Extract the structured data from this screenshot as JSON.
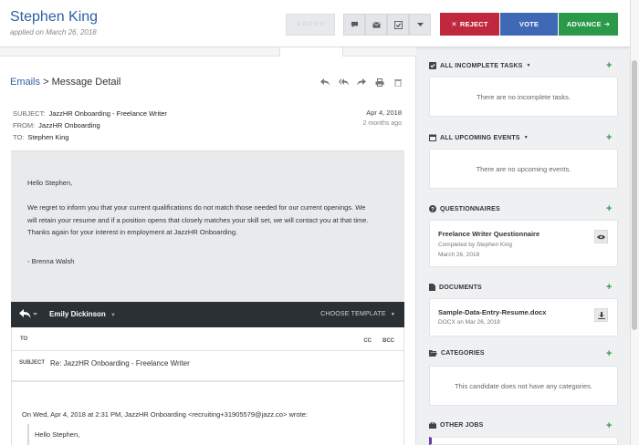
{
  "header": {
    "candidate_name": "Stephen King",
    "applied_text": "applied on March 26, 2018",
    "rating_stars": "☆☆☆☆☆",
    "actions": {
      "reject": "REJECT",
      "vote": "VOTE",
      "advance": "ADVANCE"
    }
  },
  "breadcrumb": {
    "parent": "Emails",
    "separator": " > ",
    "current": "Message Detail"
  },
  "message": {
    "subject_label": "SUBJECT:",
    "subject": "JazzHR Onboarding - Freelance Writer",
    "from_label": "FROM:",
    "from": "JazzHR Onboarding",
    "to_label": "TO:",
    "to": "Stephen King",
    "date": "Apr 4, 2018",
    "relative_date": "2 months ago",
    "greeting": "Hello Stephen,",
    "paragraph": "We regret to inform you that your current qualifications do not match those needed for our current openings. We will retain your resume and if a position opens that closely matches your skill set, we will contact you at that time. Thanks again for your interest in employment at JazzHR Onboarding.",
    "signature": "- Brenna Walsh"
  },
  "reply": {
    "from_name": "Emily Dickinson",
    "choose_template": "CHOOSE TEMPLATE",
    "to_label": "TO",
    "cc_label": "CC",
    "bcc_label": "BCC",
    "subject_label": "SUBJECT",
    "subject_value": "Re: JazzHR Onboarding - Freelance Writer",
    "quote_header": "On Wed, Apr 4, 2018 at 2:31 PM, JazzHR Onboarding <recruiting+31905579@jazz.co> wrote:",
    "quote_greeting": "Hello Stephen,"
  },
  "sidebar": {
    "tasks": {
      "title": "ALL INCOMPLETE TASKS",
      "empty": "There are no incomplete tasks."
    },
    "events": {
      "title": "ALL UPCOMING EVENTS",
      "empty": "There are no upcoming events."
    },
    "questionnaires": {
      "title": "QUESTIONNAIRES",
      "item_title": "Freelance Writer Questionnaire",
      "item_sub1": "Completed by Stephen King",
      "item_sub2": "March 26, 2018"
    },
    "documents": {
      "title": "DOCUMENTS",
      "item_title": "Sample-Data-Entry-Resume.docx",
      "item_sub": "DOCX on Mar 26, 2018"
    },
    "categories": {
      "title": "CATEGORIES",
      "empty": "This candidate does not have any categories."
    },
    "other_jobs": {
      "title": "OTHER JOBS"
    },
    "add_symbol": "+"
  },
  "colors": {
    "brand_blue": "#2f5fa3",
    "reject": "#c0283e",
    "vote": "#3f68b5",
    "advance": "#2a9a4a"
  }
}
